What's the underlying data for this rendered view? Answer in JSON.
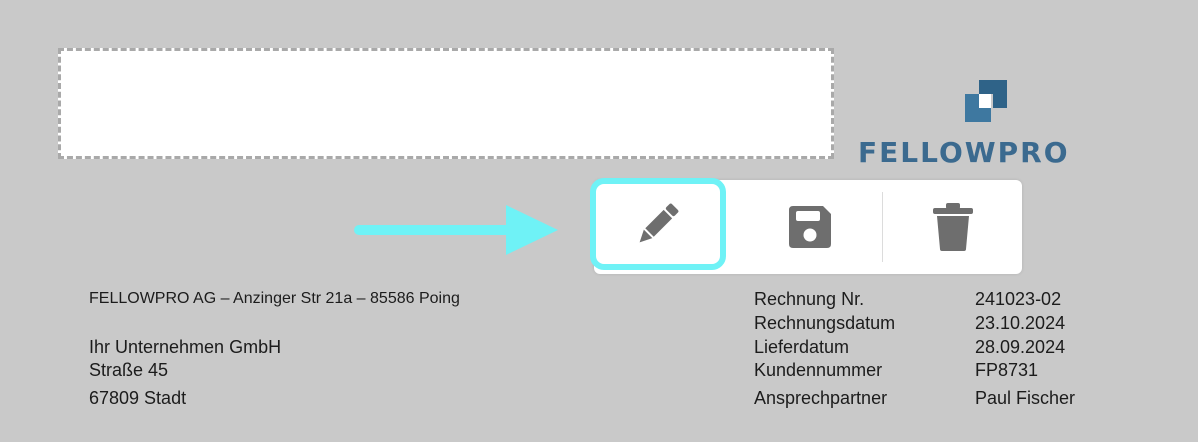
{
  "logo": {
    "name": "FELLOWPRO",
    "color": "#3b6a8f"
  },
  "toolbar": {
    "highlight_color": "#6ff2f6",
    "buttons": [
      {
        "id": "edit",
        "icon": "pencil-icon",
        "active": true
      },
      {
        "id": "save",
        "icon": "floppy-disk-icon",
        "active": false
      },
      {
        "id": "delete",
        "icon": "trash-icon",
        "active": false
      }
    ]
  },
  "sender_line": "FELLOWPRO AG – Anzinger Str 21a – 85586 Poing",
  "recipient": {
    "company": "Ihr Unternehmen GmbH",
    "street": "Straße 45",
    "city": "67809 Stadt"
  },
  "invoice_meta": [
    {
      "label": "Rechnung Nr.",
      "value": "241023-02"
    },
    {
      "label": "Rechnungsdatum",
      "value": "23.10.2024"
    },
    {
      "label": "Lieferdatum",
      "value": "28.09.2024"
    },
    {
      "label": "Kundennummer",
      "value": "FP8731"
    },
    {
      "label": "Ansprechpartner",
      "value": "Paul Fischer"
    }
  ]
}
